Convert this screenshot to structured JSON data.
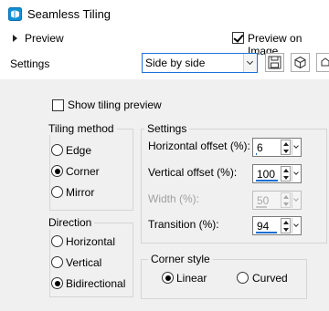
{
  "window": {
    "title": "Seamless Tiling"
  },
  "preview": {
    "expander_label": "Preview",
    "preview_on_image_label": "Preview on Image",
    "preview_on_image_checked": true
  },
  "toolbar": {
    "settings_label": "Settings",
    "preset_value": "Side by side",
    "buttons": [
      "save-icon",
      "cube-icon",
      "partial-icon"
    ]
  },
  "show_tiling_preview": {
    "label": "Show tiling preview",
    "checked": false
  },
  "tiling_method": {
    "label": "Tiling method",
    "options": [
      "Edge",
      "Corner",
      "Mirror"
    ],
    "selected": "Corner"
  },
  "direction": {
    "label": "Direction",
    "options": [
      "Horizontal",
      "Vertical",
      "Bidirectional"
    ],
    "selected": "Bidirectional"
  },
  "settings_group": {
    "label": "Settings",
    "horizontal_offset": {
      "label": "Horizontal offset (%):",
      "value": "6",
      "level": 0.06
    },
    "vertical_offset": {
      "label": "Vertical offset (%):",
      "value": "100",
      "level": 1.0
    },
    "width": {
      "label": "Width (%):",
      "value": "50",
      "level": 0.5,
      "disabled": true
    },
    "transition": {
      "label": "Transition (%):",
      "value": "94",
      "level": 0.94
    }
  },
  "corner_style": {
    "label": "Corner style",
    "options": [
      "Linear",
      "Curved"
    ],
    "selected": "Linear"
  }
}
